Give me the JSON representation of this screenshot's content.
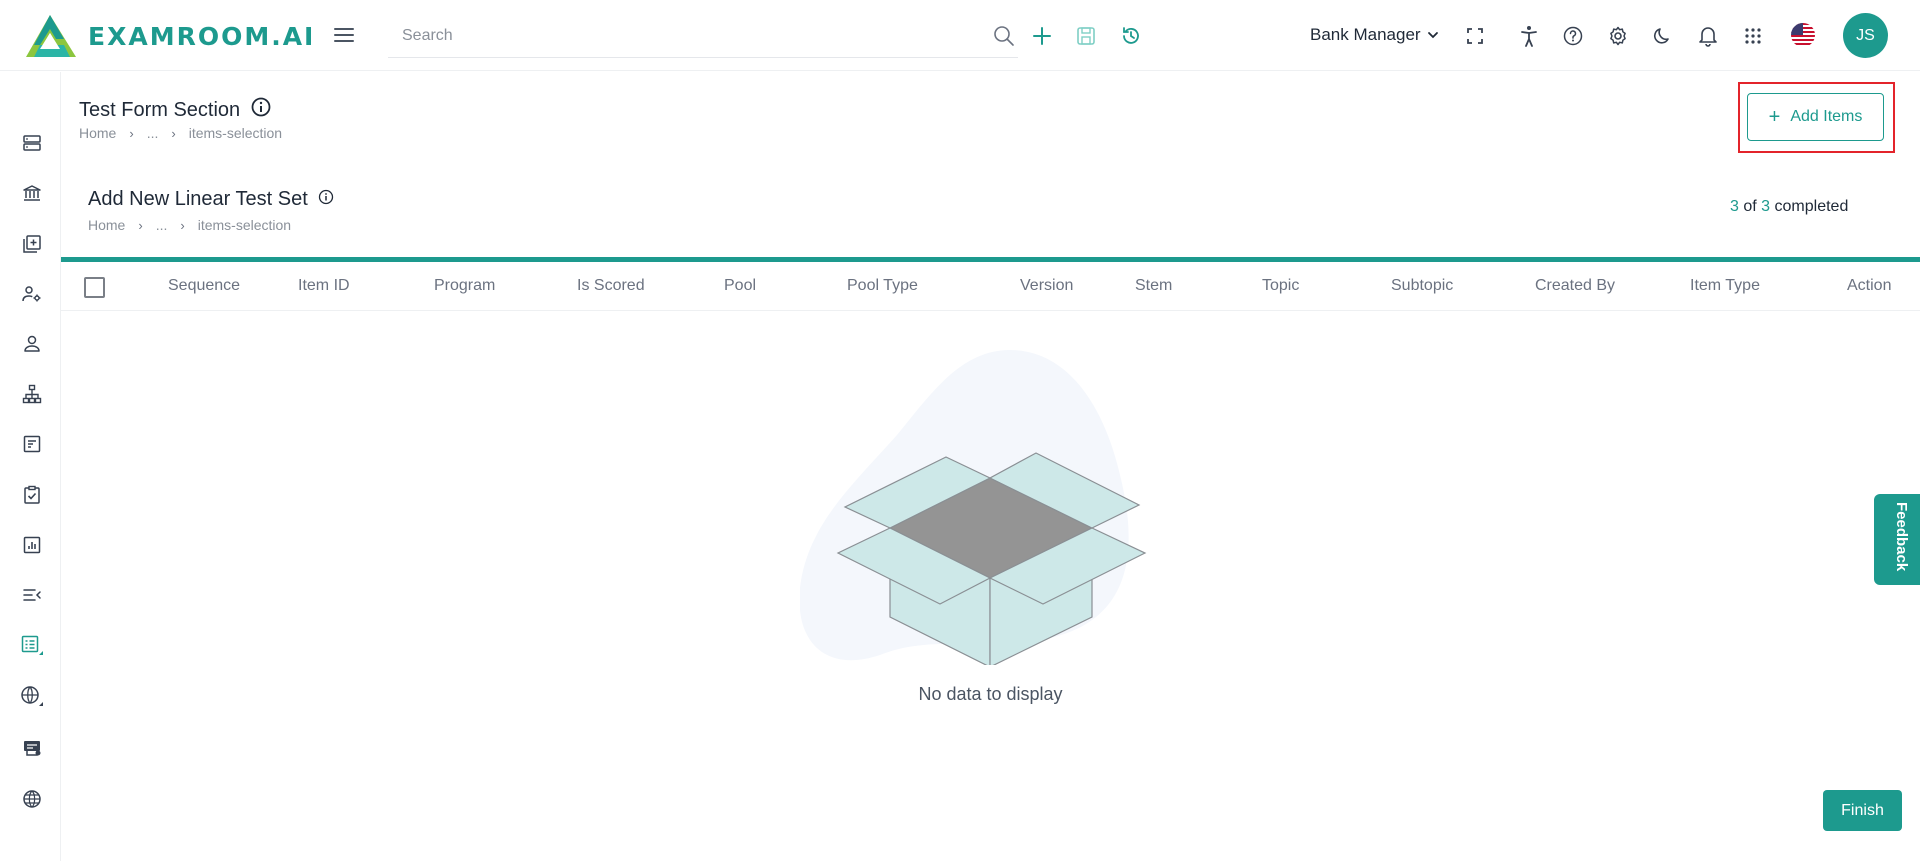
{
  "header": {
    "logo_text": "EXAMROOM.AI",
    "search_placeholder": "Search",
    "role_label": "Bank Manager",
    "avatar_initials": "JS",
    "icons": [
      "menu-icon",
      "search-icon",
      "plus-icon",
      "save-icon",
      "history-icon",
      "fullscreen-icon",
      "accessibility-icon",
      "help-icon",
      "settings-icon",
      "dark-mode-icon",
      "notification-icon",
      "apps-grid-icon",
      "us-flag-icon"
    ]
  },
  "sidebar": {
    "items": [
      "server-icon",
      "bank-icon",
      "add-library-icon",
      "user-settings-icon",
      "user-icon",
      "hierarchy-icon",
      "form-icon",
      "clipboard-check-icon",
      "report-icon",
      "list-collapse-icon",
      "test-list-icon",
      "globe-settings-icon",
      "certificate-icon",
      "globe-icon"
    ],
    "active_item": "test-list-icon"
  },
  "page": {
    "title": "Test Form Section",
    "breadcrumb": [
      "Home",
      "...",
      "items-selection"
    ],
    "add_button_label": "Add Items"
  },
  "section": {
    "title": "Add New Linear Test Set",
    "breadcrumb": [
      "Home",
      "...",
      "items-selection"
    ],
    "progress_current": "3",
    "progress_of": "of",
    "progress_total": "3",
    "progress_suffix": "completed"
  },
  "table": {
    "columns": [
      "Sequence",
      "Item ID",
      "Program",
      "Is Scored",
      "Pool",
      "Pool Type",
      "Version",
      "Stem",
      "Topic",
      "Subtopic",
      "Created By",
      "Item Type",
      "Action"
    ],
    "rows": [],
    "empty_text": "No data to display"
  },
  "feedback_label": "Feedback",
  "finish_label": "Finish",
  "colors": {
    "accent": "#1d9a8e",
    "highlight": "#e3242b"
  }
}
